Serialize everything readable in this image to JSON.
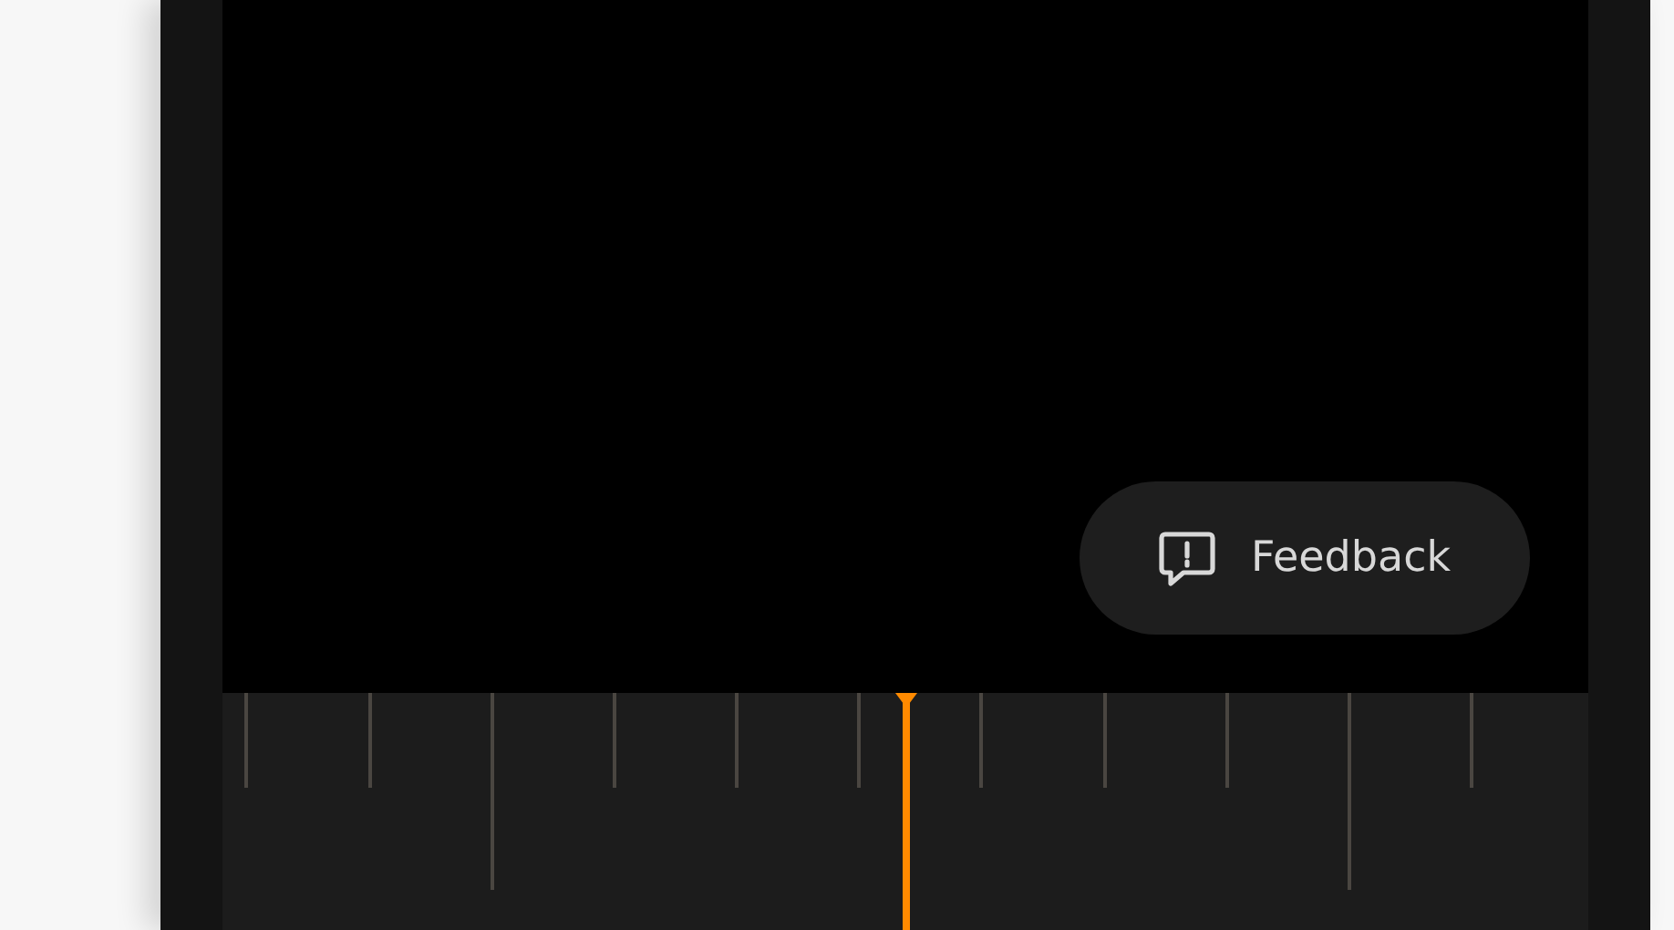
{
  "feedback_button": {
    "label": "Feedback"
  }
}
